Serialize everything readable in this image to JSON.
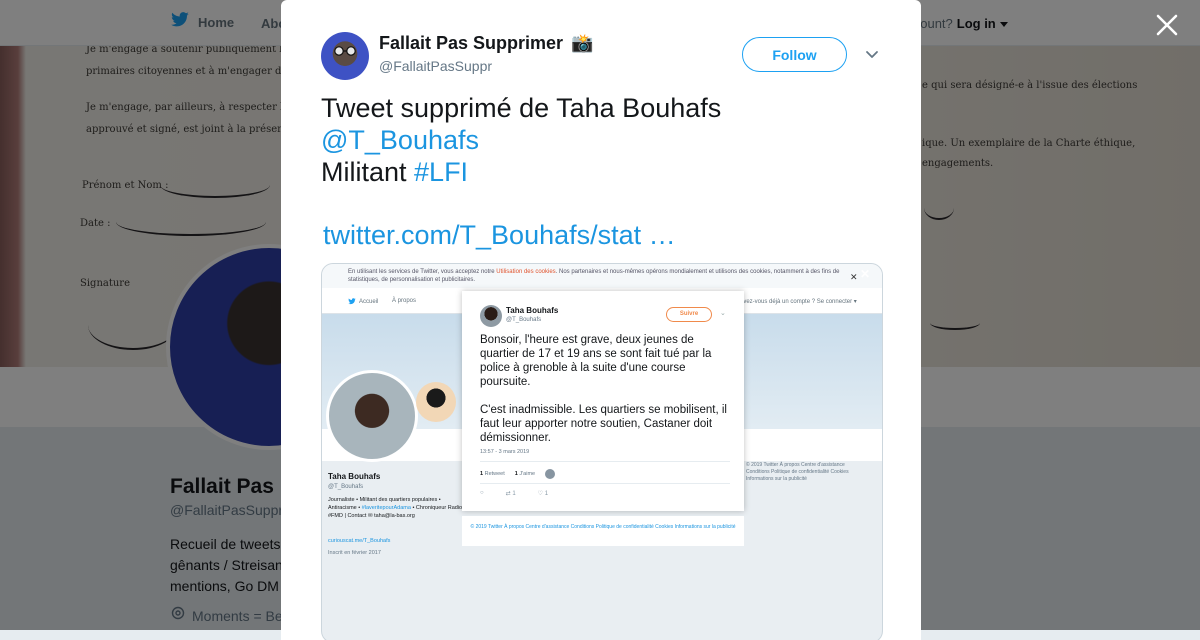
{
  "background_page": {
    "nav": {
      "home_label": "Home",
      "about_label": "Abo",
      "account_text": "account?",
      "login_label": "Log in"
    },
    "document_lines": [
      "Je m'engage à soutenir publiquement le (la)",
      "primaires citoyennes et à m'engager dans sa",
      "Je m'engage, par ailleurs, à respecter la Ch",
      "approuvé et signé, est joint à la présente décl",
      "Prénom et Nom :",
      "Date :",
      "Signature",
      "e qui sera désigné-e à l'issue des élections",
      "ique. Un exemplaire de la Charte éthique,",
      "engagements."
    ],
    "profile": {
      "name": "Fallait Pas",
      "handle": "@FallaitPasSuppr",
      "bio_lines": [
        "Recueil de tweets",
        "gênants / Streisan",
        "mentions, Go DM"
      ],
      "location": "Moments = Be"
    }
  },
  "tweet": {
    "author_name": "Fallait Pas Supprimer",
    "author_emoji": "📸",
    "author_handle": "@FallaitPasSuppr",
    "follow_label": "Follow",
    "text_line1": "Tweet supprimé de Taha Bouhafs",
    "mention": "@T_Bouhafs",
    "text_line3_prefix": "Militant ",
    "hashtag": "#LFI",
    "link": "twitter.com/T_Bouhafs/stat …",
    "media": {
      "cookie_prefix": "En utilisant les services de Twitter, vous acceptez notre ",
      "cookie_link": "Utilisation des cookies",
      "cookie_suffix": ". Nos partenaires et nous-mêmes opérons mondialement et utilisons des cookies, notamment à des fins de statistiques, de personnalisation et publicitaires.",
      "nav_home": "Accueil",
      "nav_about": "À propos",
      "nav_account": "avez-vous déjà un compte ? Se connecter ▾",
      "profile_name": "Taha Bouhafs",
      "profile_handle": "@T_Bouhafs",
      "profile_bio_prefix": "Journaliste • Militant des quartiers populaires • Antiracisme • ",
      "profile_bio_tag": "#laveritepourAdama",
      "profile_bio_suffix": " • Chroniqueur Radio #FMD | Contact ✉ taha@la-bas.org",
      "profile_link": "curiouscat.me/T_Bouhafs",
      "profile_join": "Inscrit en février 2017",
      "right_footer": "© 2019 Twitter   À propos   Centre d'assistance   Conditions   Politique de confidentialité   Cookies   Informations sur la publicité",
      "embed": {
        "name": "Taha Bouhafs",
        "handle": "@T_Bouhafs",
        "follow_label": "Suivre",
        "text_para1": "Bonsoir, l'heure est grave, deux jeunes de quartier de 17 et 19 ans se sont fait tué par la police à grenoble à la suite d'une course poursuite.",
        "text_para2": "C'est inadmissible. Les quartiers se mobilisent, il faut leur apporter notre soutien, Castaner doit démissionner.",
        "timestamp": "13:57 - 3 mars 2019",
        "retweets_count": "1",
        "retweets_label": "Retweet",
        "likes_count": "1",
        "likes_label": "J'aime",
        "reply_count": "",
        "rt_count_action": "1",
        "like_count_action": "1",
        "footer": "© 2019 Twitter   À propos   Centre d'assistance   Conditions   Politique de confidentialité   Cookies   Informations sur la publicité"
      }
    }
  },
  "colors": {
    "accent": "#1da1f2",
    "link": "#1b95e0",
    "text": "#14171a",
    "muted": "#657786",
    "overlay": "rgba(0,0,0,0.5)"
  },
  "icons": [
    "twitter-bird-icon",
    "close-icon",
    "chevron-down-icon",
    "camera-emoji-icon",
    "location-pin-icon",
    "reply-icon",
    "retweet-icon",
    "like-icon"
  ]
}
